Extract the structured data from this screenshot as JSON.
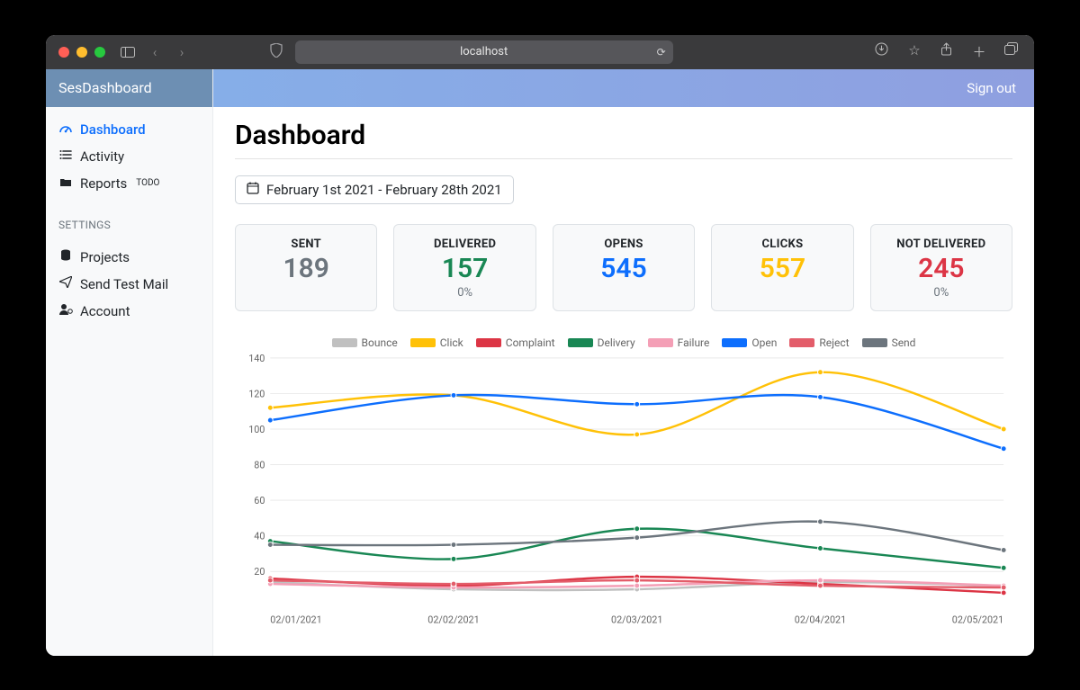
{
  "browser": {
    "address": "localhost"
  },
  "brand": "SesDashboard",
  "topbar": {
    "signout": "Sign out"
  },
  "sidebar": {
    "items": [
      {
        "label": "Dashboard",
        "badge": ""
      },
      {
        "label": "Activity",
        "badge": ""
      },
      {
        "label": "Reports",
        "badge": "TODO"
      }
    ],
    "settings_label": "SETTINGS",
    "settings": [
      {
        "label": "Projects"
      },
      {
        "label": "Send Test Mail"
      },
      {
        "label": "Account"
      }
    ]
  },
  "page": {
    "title": "Dashboard",
    "date_range": "February 1st 2021 - February 28th 2021"
  },
  "cards": {
    "sent": {
      "label": "SENT",
      "value": "189",
      "sub": ""
    },
    "delivered": {
      "label": "DELIVERED",
      "value": "157",
      "sub": "0%"
    },
    "opens": {
      "label": "OPENS",
      "value": "545",
      "sub": ""
    },
    "clicks": {
      "label": "CLICKS",
      "value": "557",
      "sub": ""
    },
    "notdelivered": {
      "label": "NOT DELIVERED",
      "value": "245",
      "sub": "0%"
    }
  },
  "chart_data": {
    "type": "line",
    "title": "",
    "xlabel": "",
    "ylabel": "",
    "ylim": [
      0,
      140
    ],
    "yticks": [
      20,
      40,
      60,
      80,
      100,
      120,
      140
    ],
    "categories": [
      "02/01/2021",
      "02/02/2021",
      "02/03/2021",
      "02/04/2021",
      "02/05/2021"
    ],
    "series": [
      {
        "name": "Bounce",
        "color": "#c0c0c0",
        "values": [
          14,
          10,
          10,
          14,
          12
        ]
      },
      {
        "name": "Click",
        "color": "#ffc107",
        "values": [
          112,
          119,
          97,
          132,
          100
        ]
      },
      {
        "name": "Complaint",
        "color": "#dc3545",
        "values": [
          16,
          12,
          17,
          13,
          8
        ]
      },
      {
        "name": "Delivery",
        "color": "#198754",
        "values": [
          37,
          27,
          44,
          33,
          22
        ]
      },
      {
        "name": "Failure",
        "color": "#f49fb6",
        "values": [
          13,
          11,
          12,
          15,
          12
        ]
      },
      {
        "name": "Open",
        "color": "#0d6efd",
        "values": [
          105,
          119,
          114,
          118,
          89
        ]
      },
      {
        "name": "Reject",
        "color": "#e35d6a",
        "values": [
          15,
          13,
          15,
          12,
          11
        ]
      },
      {
        "name": "Send",
        "color": "#6c757d",
        "values": [
          35,
          35,
          39,
          48,
          32
        ]
      }
    ]
  }
}
